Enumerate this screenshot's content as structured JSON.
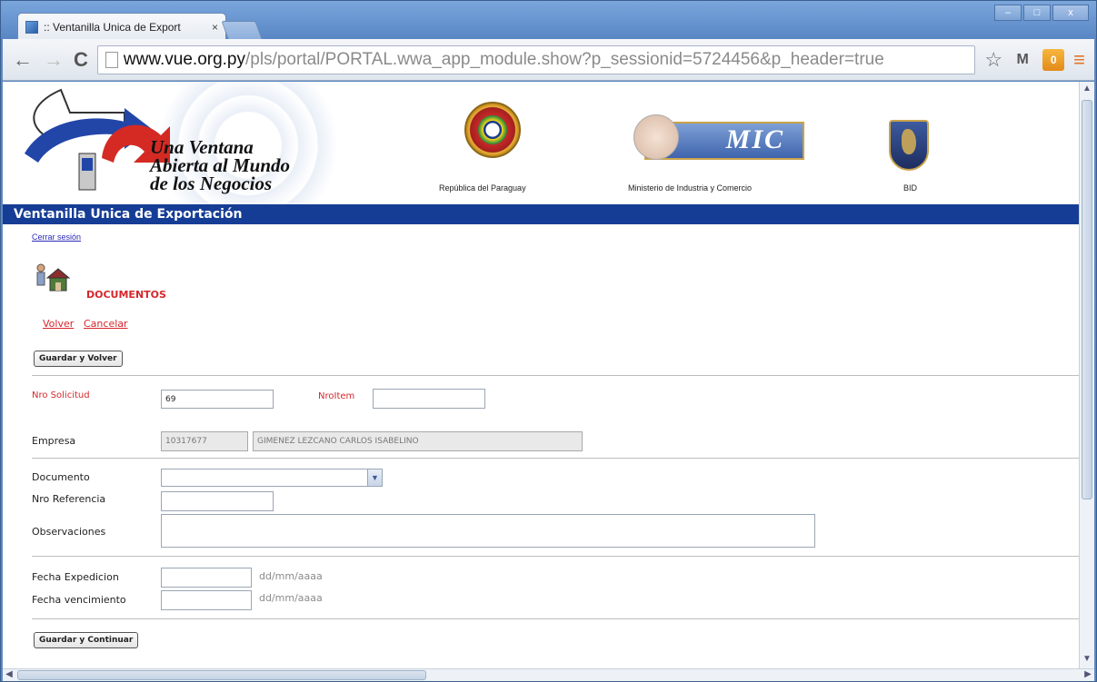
{
  "browser": {
    "tab_title": ":: Ventanilla Unica de Export",
    "tab_close": "×",
    "window_controls": {
      "minimize": "–",
      "maximize": "□",
      "close": "x"
    },
    "url_host": "www.vue.org.py",
    "url_path": "/pls/portal/PORTAL.wwa_app_module.show?p_sessionid=5724456&p_header=true",
    "ext_badge": "0"
  },
  "banner": {
    "slogan_line1": "Una Ventana",
    "slogan_line2": "Abierta al Mundo",
    "slogan_line3": "de los Negocios",
    "logo1_caption": "República del Paraguay",
    "logo2_caption": "Ministerio de Industria y Comercio",
    "logo2_text": "MIC",
    "logo3_caption": "BID"
  },
  "page": {
    "header_title": "Ventanilla Unica de Exportación",
    "cerrar_sesion": "Cerrar sesión",
    "section_title": "DOCUMENTOS",
    "volver": "Volver",
    "cancelar": "Cancelar",
    "guardar_volver": "Guardar y Volver",
    "guardar_continuar": "Guardar y Continuar"
  },
  "form": {
    "nro_solicitud_label": "Nro Solicitud",
    "nro_solicitud_value": "69",
    "nroitem_label": "NroItem",
    "nroitem_value": "",
    "empresa_label": "Empresa",
    "empresa_ruc": "10317677",
    "empresa_name": "GIMENEZ LEZCANO CARLOS ISABELINO",
    "documento_label": "Documento",
    "documento_value": "",
    "nro_referencia_label": "Nro Referencia",
    "nro_referencia_value": "",
    "observaciones_label": "Observaciones",
    "observaciones_value": "",
    "fecha_expedicion_label": "Fecha Expedicion",
    "fecha_expedicion_value": "",
    "fecha_vencimiento_label": "Fecha vencimiento",
    "fecha_vencimiento_value": "",
    "date_hint": "dd/mm/aaaa"
  }
}
